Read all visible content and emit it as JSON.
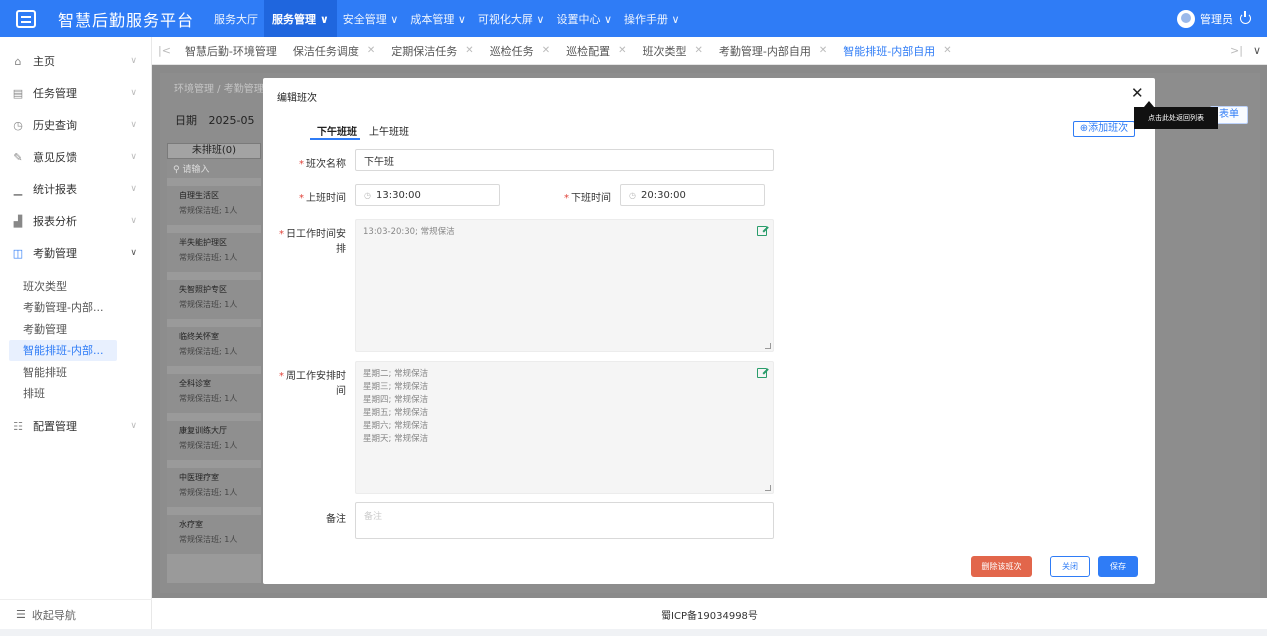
{
  "app": {
    "title": "智慧后勤服务平台"
  },
  "nav": [
    {
      "label": "服务大厅",
      "active": false
    },
    {
      "label": "服务管理 ∨",
      "active": true
    },
    {
      "label": "安全管理 ∨",
      "active": false
    },
    {
      "label": "成本管理 ∨",
      "active": false
    },
    {
      "label": "可视化大屏 ∨",
      "active": false
    },
    {
      "label": "设置中心 ∨",
      "active": false
    },
    {
      "label": "操作手册 ∨",
      "active": false
    }
  ],
  "user": {
    "name": "管理员"
  },
  "sidebar": {
    "items": [
      {
        "label": "主页",
        "icon": "home-icon",
        "glyph": "⌂"
      },
      {
        "label": "任务管理",
        "icon": "task-icon",
        "glyph": "▤"
      },
      {
        "label": "历史查询",
        "icon": "history-icon",
        "glyph": "◷"
      },
      {
        "label": "意见反馈",
        "icon": "feedback-icon",
        "glyph": "✎"
      },
      {
        "label": "统计报表",
        "icon": "chart-icon",
        "glyph": "▁"
      },
      {
        "label": "报表分析",
        "icon": "analysis-icon",
        "glyph": "▟"
      },
      {
        "label": "考勤管理",
        "icon": "attendance-icon",
        "glyph": "◫"
      }
    ],
    "sub_items": [
      "班次类型",
      "考勤管理-内部...",
      "考勤管理",
      "智能排班-内部...",
      "智能排班",
      "排班"
    ],
    "config": {
      "label": "配置管理",
      "glyph": "☷"
    },
    "collapse": "收起导航"
  },
  "tabs": [
    "智慧后勤-环境管理",
    "保洁任务调度",
    "定期保洁任务",
    "巡检任务",
    "巡检配置",
    "班次类型",
    "考勤管理-内部自用",
    "智能排班-内部自用"
  ],
  "background": {
    "breadcrumb": "环境管理 / 考勤管理",
    "date_label": "日期",
    "date_value": "2025-05",
    "unscheduled": "未排班(0)",
    "search_placeholder": "请输入",
    "areas": [
      {
        "name": "自理生活区",
        "desc": "常规保洁班; 1人"
      },
      {
        "name": "半失能护理区",
        "desc": "常规保洁班; 1人"
      },
      {
        "name": "失智照护专区",
        "desc": "常规保洁班; 1人"
      },
      {
        "name": "临终关怀室",
        "desc": "常规保洁班; 1人"
      },
      {
        "name": "全科诊室",
        "desc": "常规保洁班; 1人"
      },
      {
        "name": "康复训练大厅",
        "desc": "常规保洁班; 1人"
      },
      {
        "name": "中医理疗室",
        "desc": "常规保洁班; 1人"
      },
      {
        "name": "水疗室",
        "desc": "常规保洁班; 1人"
      }
    ],
    "list_button": "表单"
  },
  "modal": {
    "title": "编辑班次",
    "tooltip": "点击此处返回列表",
    "tabs": [
      "下午班班",
      "上午班班"
    ],
    "add_shift": "⊕添加班次",
    "form": {
      "name_label": "班次名称",
      "name_value": "下午班",
      "start_label": "上班时间",
      "start_value": "13:30:00",
      "end_label": "下班时间",
      "end_value": "20:30:00",
      "daily_label": "日工作时间安排",
      "daily_value": "13:03-20:30; 常规保洁",
      "weekly_label": "周工作安排时间",
      "weekly_values": [
        "星期二; 常规保洁",
        "星期三; 常规保洁",
        "星期四; 常规保洁",
        "星期五; 常规保洁",
        "星期六; 常规保洁",
        "星期天; 常规保洁"
      ],
      "remark_label": "备注",
      "remark_placeholder": "备注"
    },
    "buttons": {
      "delete": "删除该班次",
      "close": "关闭",
      "save": "保存"
    }
  },
  "footer": {
    "icp": "蜀ICP备19034998号"
  }
}
